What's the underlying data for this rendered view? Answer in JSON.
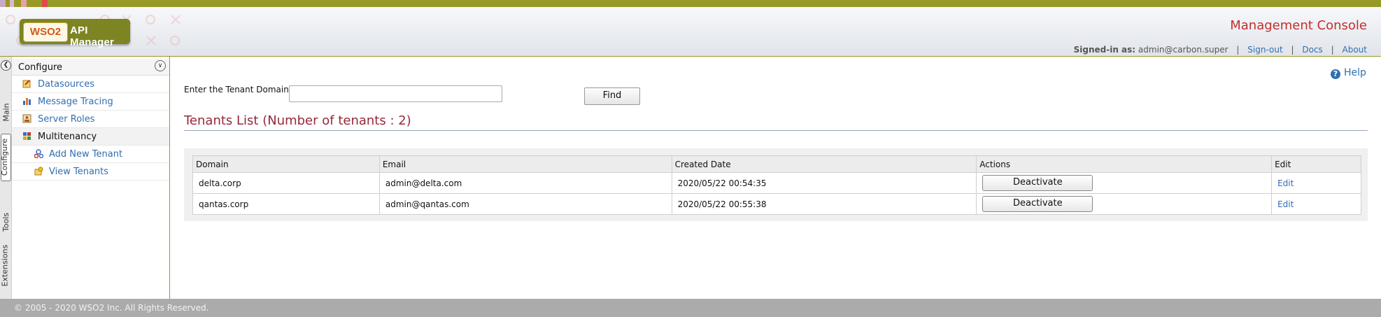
{
  "header": {
    "logo_brand": "WSO2",
    "app_name": "API Manager",
    "console_title": "Management Console",
    "signed_in_label": "Signed-in as:",
    "user": "admin@carbon.super",
    "links": [
      "Sign-out",
      "Docs",
      "About"
    ]
  },
  "side_tabs": [
    "Main",
    "Configure",
    "Tools",
    "Extensions"
  ],
  "menu": {
    "title": "Configure",
    "items": [
      {
        "label": "Datasources",
        "icon": "datasource-icon"
      },
      {
        "label": "Message Tracing",
        "icon": "tracing-chart-icon"
      },
      {
        "label": "Server Roles",
        "icon": "server-roles-icon"
      },
      {
        "label": "Multitenancy",
        "icon": "multitenancy-icon"
      },
      {
        "label": "Add New Tenant",
        "icon": "add-tenant-icon"
      },
      {
        "label": "View Tenants",
        "icon": "view-tenants-icon"
      }
    ]
  },
  "help_label": "Help",
  "search": {
    "label": "Enter the Tenant Domain",
    "value": "",
    "button": "Find"
  },
  "tenants_title": "Tenants List (Number of tenants : 2)",
  "table": {
    "columns": [
      "Domain",
      "Email",
      "Created Date",
      "Actions",
      "Edit"
    ],
    "rows": [
      {
        "domain": "delta.corp",
        "email": "admin@delta.com",
        "created": "2020/05/22 00:54:35",
        "action": "Deactivate",
        "edit": "Edit"
      },
      {
        "domain": "qantas.corp",
        "email": "admin@qantas.com",
        "created": "2020/05/22 00:55:38",
        "action": "Deactivate",
        "edit": "Edit"
      }
    ]
  },
  "footer": "© 2005 - 2020 WSO2 Inc. All Rights Reserved.",
  "colors": {
    "top_stripe": "#979a25",
    "console_title": "#c22f2f",
    "section_title": "#96283a",
    "link": "#2f6fb0",
    "footer_bg": "#ababab"
  }
}
